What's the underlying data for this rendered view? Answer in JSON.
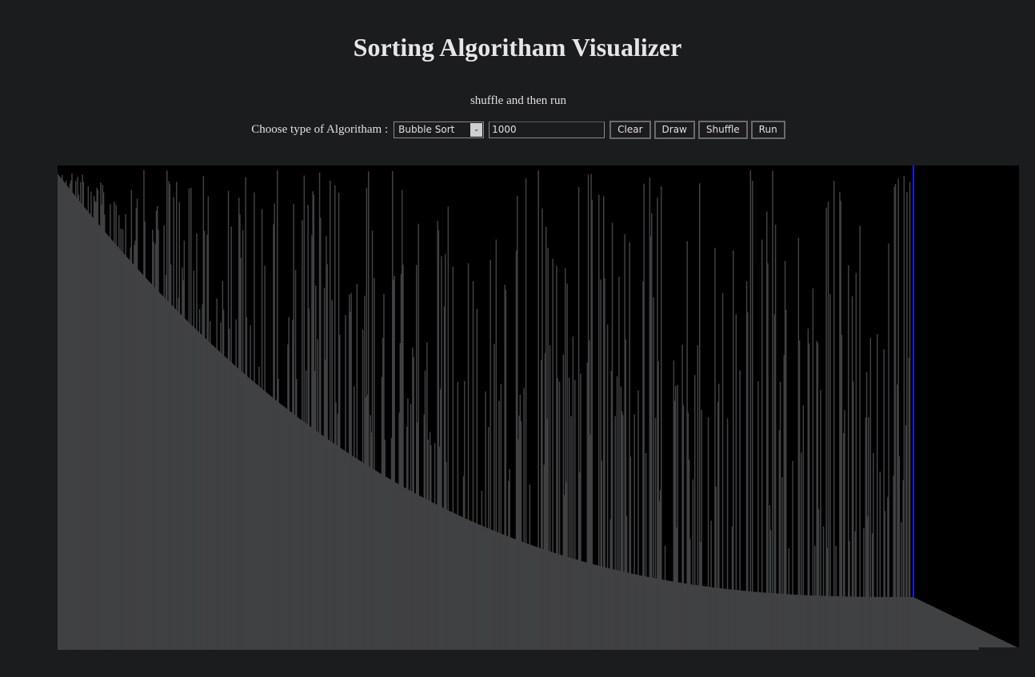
{
  "page": {
    "title": "Sorting Algoritham Visualizer",
    "hint": "shuffle and then run"
  },
  "controls": {
    "algorithm_label": "Choose type of Algoritham :",
    "algorithm_selected": "Bubble Sort",
    "count_value": "1000",
    "clear_label": "Clear",
    "draw_label": "Draw",
    "shuffle_label": "Shuffle",
    "run_label": "Run"
  },
  "visualizer": {
    "background_color": "#000000",
    "bar_color": "#404142",
    "highlight_color": "#1a1aff",
    "total_bars": 1000,
    "sorted_tail_fraction": 0.11,
    "highlight_fraction": 0.89
  }
}
